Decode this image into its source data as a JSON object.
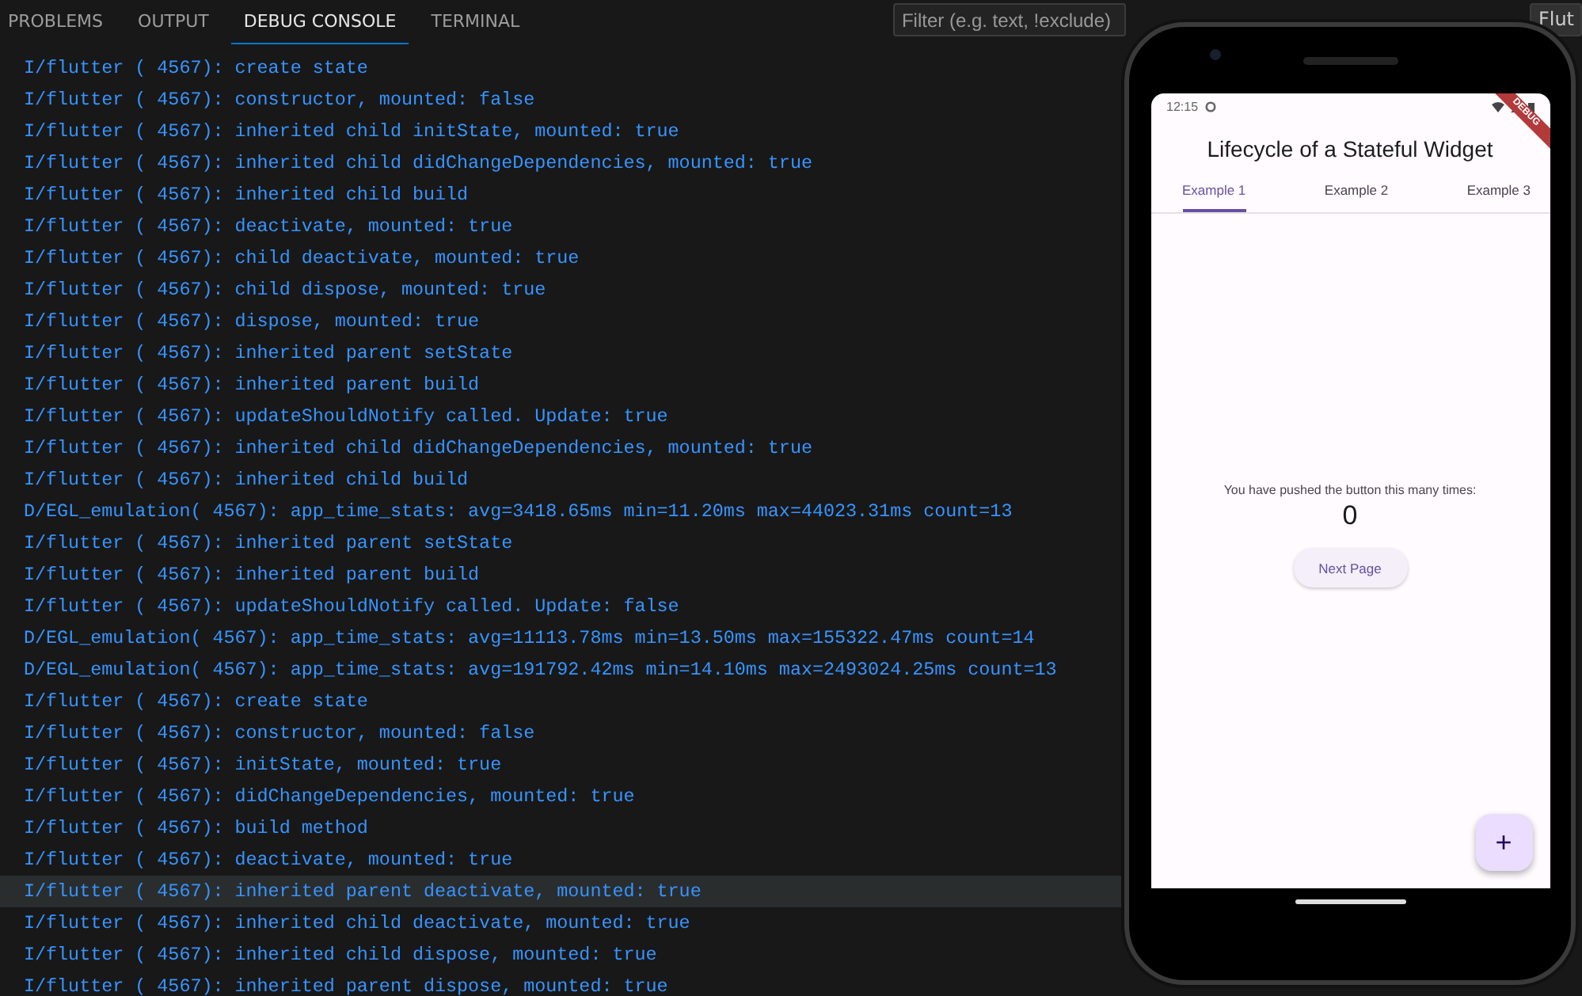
{
  "panel_tabs": [
    {
      "label": "PROBLEMS",
      "selected": false
    },
    {
      "label": "OUTPUT",
      "selected": false
    },
    {
      "label": "DEBUG CONSOLE",
      "selected": true
    },
    {
      "label": "TERMINAL",
      "selected": false
    }
  ],
  "filter": {
    "placeholder": "Filter (e.g. text, !exclude)"
  },
  "dropdown": {
    "value": "Flut"
  },
  "console_lines": [
    {
      "text": "I/flutter ( 4567): create state",
      "highlighted": false
    },
    {
      "text": "I/flutter ( 4567): constructor, mounted: false",
      "highlighted": false
    },
    {
      "text": "I/flutter ( 4567): inherited child initState, mounted: true",
      "highlighted": false
    },
    {
      "text": "I/flutter ( 4567): inherited child didChangeDependencies, mounted: true",
      "highlighted": false
    },
    {
      "text": "I/flutter ( 4567): inherited child build",
      "highlighted": false
    },
    {
      "text": "I/flutter ( 4567): deactivate, mounted: true",
      "highlighted": false
    },
    {
      "text": "I/flutter ( 4567): child deactivate, mounted: true",
      "highlighted": false
    },
    {
      "text": "I/flutter ( 4567): child dispose, mounted: true",
      "highlighted": false
    },
    {
      "text": "I/flutter ( 4567): dispose, mounted: true",
      "highlighted": false
    },
    {
      "text": "I/flutter ( 4567): inherited parent setState",
      "highlighted": false
    },
    {
      "text": "I/flutter ( 4567): inherited parent build",
      "highlighted": false
    },
    {
      "text": "I/flutter ( 4567): updateShouldNotify called. Update: true",
      "highlighted": false
    },
    {
      "text": "I/flutter ( 4567): inherited child didChangeDependencies, mounted: true",
      "highlighted": false
    },
    {
      "text": "I/flutter ( 4567): inherited child build",
      "highlighted": false
    },
    {
      "text": "D/EGL_emulation( 4567): app_time_stats: avg=3418.65ms min=11.20ms max=44023.31ms count=13",
      "highlighted": false
    },
    {
      "text": "I/flutter ( 4567): inherited parent setState",
      "highlighted": false
    },
    {
      "text": "I/flutter ( 4567): inherited parent build",
      "highlighted": false
    },
    {
      "text": "I/flutter ( 4567): updateShouldNotify called. Update: false",
      "highlighted": false
    },
    {
      "text": "D/EGL_emulation( 4567): app_time_stats: avg=11113.78ms min=13.50ms max=155322.47ms count=14",
      "highlighted": false
    },
    {
      "text": "D/EGL_emulation( 4567): app_time_stats: avg=191792.42ms min=14.10ms max=2493024.25ms count=13",
      "highlighted": false
    },
    {
      "text": "I/flutter ( 4567): create state",
      "highlighted": false
    },
    {
      "text": "I/flutter ( 4567): constructor, mounted: false",
      "highlighted": false
    },
    {
      "text": "I/flutter ( 4567): initState, mounted: true",
      "highlighted": false
    },
    {
      "text": "I/flutter ( 4567): didChangeDependencies, mounted: true",
      "highlighted": false
    },
    {
      "text": "I/flutter ( 4567): build method",
      "highlighted": false
    },
    {
      "text": "I/flutter ( 4567): deactivate, mounted: true",
      "highlighted": false
    },
    {
      "text": "I/flutter ( 4567): inherited parent deactivate, mounted: true",
      "highlighted": true
    },
    {
      "text": "I/flutter ( 4567): inherited child deactivate, mounted: true",
      "highlighted": false
    },
    {
      "text": "I/flutter ( 4567): inherited child dispose, mounted: true",
      "highlighted": false
    },
    {
      "text": "I/flutter ( 4567): inherited parent dispose, mounted: true",
      "highlighted": false
    }
  ],
  "phone": {
    "status_time": "12:15",
    "debug_banner": "DEBUG",
    "app_title": "Lifecycle of a Stateful Widget",
    "tabs": [
      {
        "label": "Example 1",
        "selected": true
      },
      {
        "label": "Example 2",
        "selected": false
      },
      {
        "label": "Example 3",
        "selected": false
      }
    ],
    "message": "You have pushed the button this many times:",
    "counter": "0",
    "next_button": "Next Page",
    "fab": "+"
  }
}
